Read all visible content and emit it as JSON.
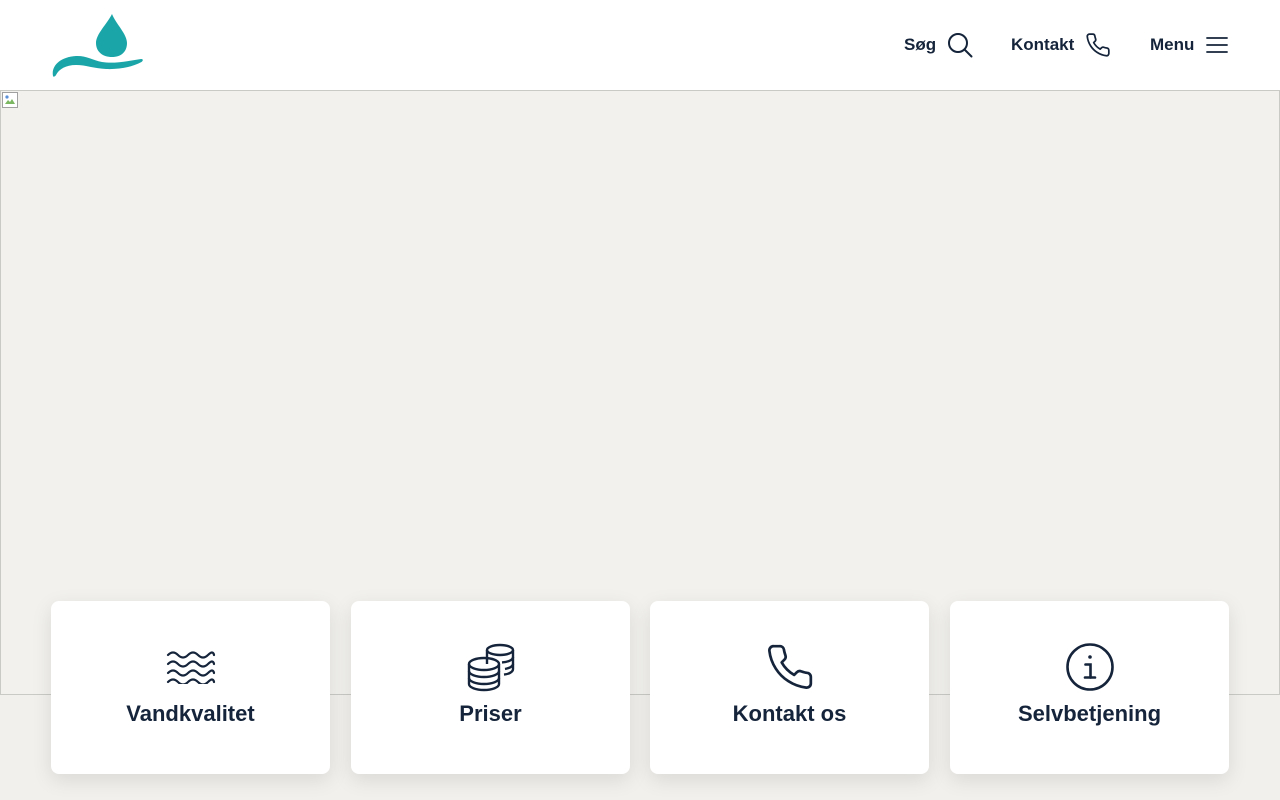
{
  "header": {
    "logo_icon": "water-drop-hand-logo",
    "brand_color": "#1aa6a8",
    "nav": [
      {
        "label": "Søg",
        "icon": "search-icon"
      },
      {
        "label": "Kontakt",
        "icon": "phone-icon"
      },
      {
        "label": "Menu",
        "icon": "hamburger-menu-icon"
      }
    ]
  },
  "hero": {
    "image_icon": "broken-image-icon"
  },
  "quick_links": [
    {
      "label": "Vandkvalitet",
      "icon": "waves-icon"
    },
    {
      "label": "Priser",
      "icon": "coins-icon"
    },
    {
      "label": "Kontakt os",
      "icon": "phone-icon"
    },
    {
      "label": "Selvbetjening",
      "icon": "info-icon"
    }
  ],
  "colors": {
    "text": "#15243a",
    "background": "#f2f0ec",
    "card": "#ffffff"
  }
}
